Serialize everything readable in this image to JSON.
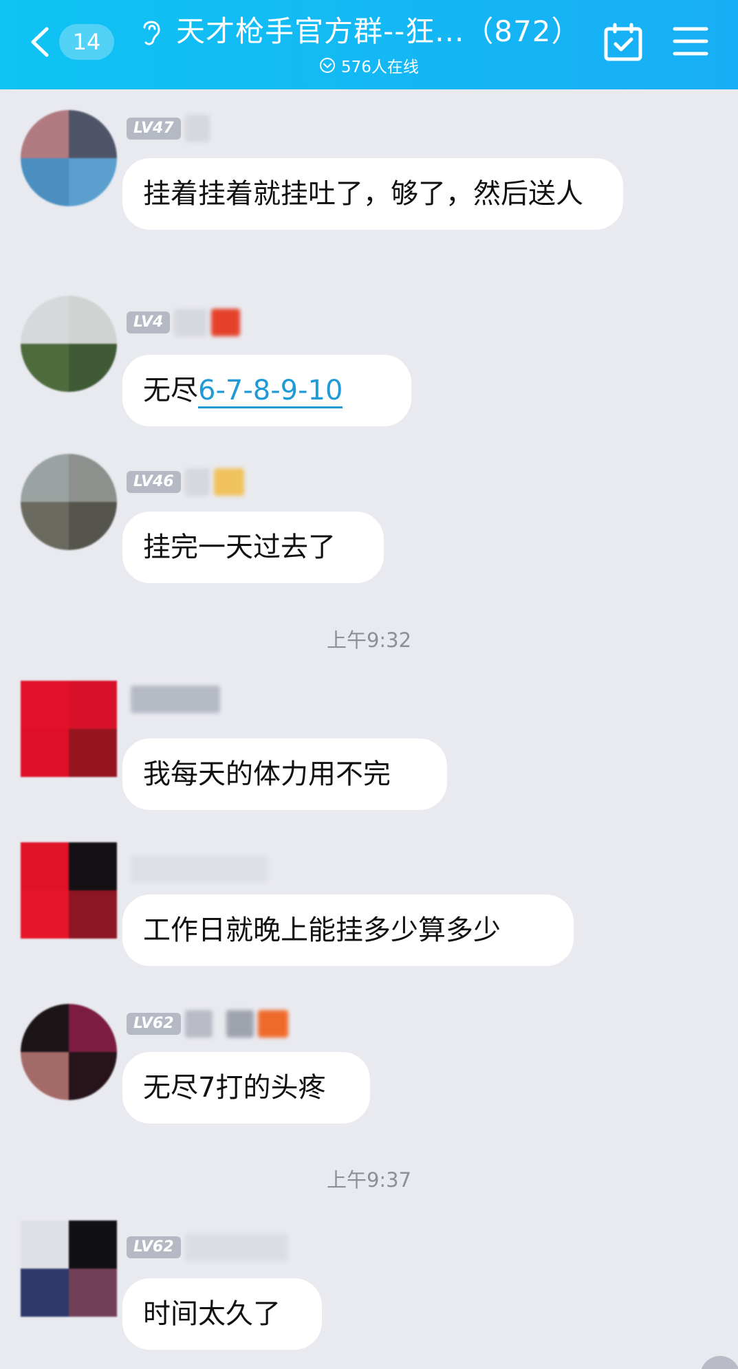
{
  "header": {
    "unread_count": "14",
    "title": "天才枪手官方群--狂...（872）",
    "online_status": "576人在线",
    "colors": {
      "gradient_start": "#0fc3f4",
      "gradient_end": "#18aef5"
    }
  },
  "chat": {
    "messages": [
      {
        "level": "LV47",
        "text": "挂着挂着就挂吐了，够了，然后送人"
      },
      {
        "level": "LV4",
        "text_prefix": "无尽",
        "link_text": "6-7-8-9-10"
      },
      {
        "level": "LV46",
        "text": "挂完一天过去了"
      },
      {
        "time": "上午9:32"
      },
      {
        "level": "",
        "text": "我每天的体力用不完"
      },
      {
        "level": "",
        "text": "工作日就晚上能挂多少算多少"
      },
      {
        "level": "LV62",
        "text": "无尽7打的头疼"
      },
      {
        "time": "上午9:37"
      },
      {
        "level": "LV62",
        "text": "时间太久了"
      }
    ]
  }
}
